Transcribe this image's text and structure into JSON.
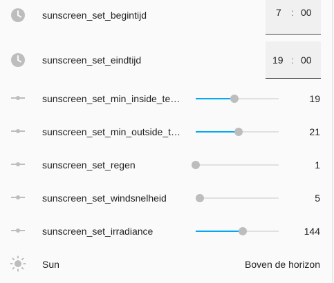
{
  "rows": {
    "begintijd": {
      "label": "sunscreen_set_begintijd",
      "hour": "7",
      "minute": "00",
      "separator": ":",
      "icon": "clock-icon"
    },
    "eindtijd": {
      "label": "sunscreen_set_eindtijd",
      "hour": "19",
      "minute": "00",
      "separator": ":",
      "icon": "clock-icon"
    },
    "min_inside": {
      "label": "sunscreen_set_min_inside_te…",
      "value": "19",
      "level": 0.47,
      "icon": "slider-icon"
    },
    "min_outside": {
      "label": "sunscreen_set_min_outside_t…",
      "value": "21",
      "level": 0.52,
      "icon": "slider-icon"
    },
    "regen": {
      "label": "sunscreen_set_regen",
      "value": "1",
      "level": 0.0,
      "icon": "slider-icon"
    },
    "windsnelheid": {
      "label": "sunscreen_set_windsnelheid",
      "value": "5",
      "level": 0.05,
      "icon": "slider-icon"
    },
    "irradiance": {
      "label": "sunscreen_set_irradiance",
      "value": "144",
      "level": 0.57,
      "icon": "slider-icon"
    },
    "sun": {
      "label": "Sun",
      "value": "Boven de horizon",
      "icon": "sun-icon"
    }
  },
  "colors": {
    "accent": "#03a9f4",
    "icon": "#bdbdbd",
    "thumb": "#bdbdbd",
    "track": "#e0e0e0"
  }
}
